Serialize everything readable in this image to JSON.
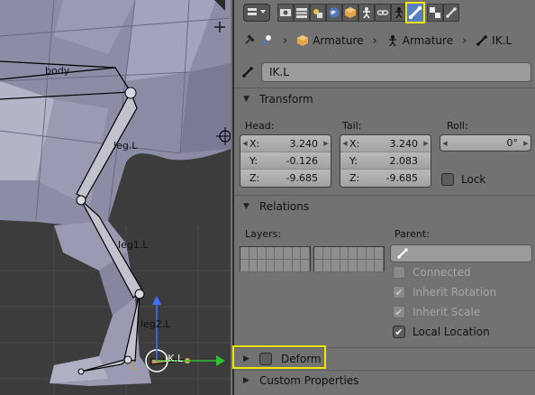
{
  "viewport": {
    "bone_labels": [
      "body",
      "leg.L",
      "leg1.L",
      "leg2.L",
      "IK.L",
      "L"
    ]
  },
  "tabs": [
    {
      "icon": "render-icon"
    },
    {
      "icon": "render-layers-icon"
    },
    {
      "icon": "scene-icon"
    },
    {
      "icon": "world-icon"
    },
    {
      "icon": "object-icon"
    },
    {
      "icon": "armature-data-icon"
    },
    {
      "icon": "constraints-icon"
    },
    {
      "icon": "bone-icon",
      "active": true
    },
    {
      "icon": "texture-icon"
    },
    {
      "icon": "bone-constraints-icon"
    }
  ],
  "breadcrumb": {
    "items": [
      "Armature",
      "Armature",
      "IK.L"
    ]
  },
  "bone": {
    "name": "IK.L"
  },
  "transform": {
    "header": "Transform",
    "head_label": "Head:",
    "tail_label": "Tail:",
    "roll_label": "Roll:",
    "head": [
      {
        "axis": "X:",
        "value": "3.240"
      },
      {
        "axis": "Y:",
        "value": "-0.126"
      },
      {
        "axis": "Z:",
        "value": "-9.685"
      }
    ],
    "tail": [
      {
        "axis": "X:",
        "value": "3.240"
      },
      {
        "axis": "Y:",
        "value": "2.083"
      },
      {
        "axis": "Z:",
        "value": "-9.685"
      }
    ],
    "roll": "0°",
    "lock_label": "Lock"
  },
  "relations": {
    "header": "Relations",
    "layers_label": "Layers:",
    "parent_label": "Parent:",
    "connected_label": "Connected",
    "inherit_rotation_label": "Inherit Rotation",
    "inherit_scale_label": "Inherit Scale",
    "local_location_label": "Local Location"
  },
  "deform": {
    "header": "Deform"
  },
  "custom_properties": {
    "header": "Custom Properties"
  },
  "colors": {
    "highlight": "#f0e600",
    "active_tab": "#5680c2",
    "x_axis": "#d8363b",
    "y_axis": "#30c030",
    "z_axis": "#3d72ff"
  }
}
